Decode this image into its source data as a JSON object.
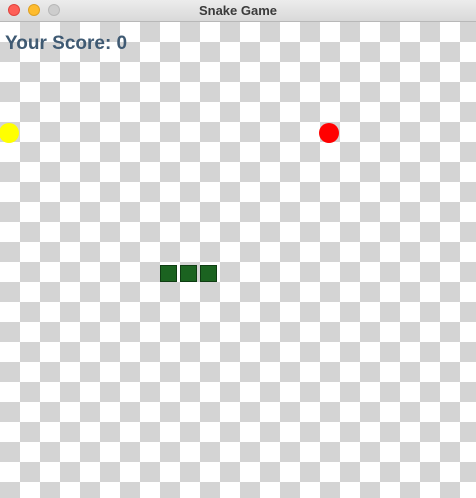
{
  "window": {
    "title": "Snake Game"
  },
  "score": {
    "text": "Your Score: 0",
    "color": "#3f5a73"
  },
  "game": {
    "snake_color": "#1b6320",
    "food_items": [
      {
        "name": "food-yellow",
        "color": "#ffff00"
      },
      {
        "name": "food-red",
        "color": "#ff0000"
      }
    ]
  }
}
